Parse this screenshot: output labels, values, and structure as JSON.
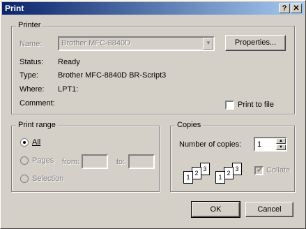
{
  "window": {
    "title": "Print",
    "help_btn": "?",
    "close_btn": "✕"
  },
  "printer": {
    "group_label": "Printer",
    "name_label": "Name:",
    "name_value": "Brother MFC-8840D",
    "properties_button": "Properties...",
    "status_label": "Status:",
    "status_value": "Ready",
    "type_label": "Type:",
    "type_value": "Brother MFC-8840D BR-Script3",
    "where_label": "Where:",
    "where_value": "LPT1:",
    "comment_label": "Comment:",
    "print_to_file": "Print to file"
  },
  "print_range": {
    "group_label": "Print range",
    "all": "All",
    "pages": "Pages",
    "from_label": "from:",
    "to_label": "to:",
    "selection": "Selection"
  },
  "copies": {
    "group_label": "Copies",
    "number_label": "Number of copies:",
    "number_value": "1",
    "collate": "Collate",
    "collate_checked": true,
    "page_numbers": [
      "1",
      "2",
      "3"
    ]
  },
  "buttons": {
    "ok": "OK",
    "cancel": "Cancel"
  }
}
